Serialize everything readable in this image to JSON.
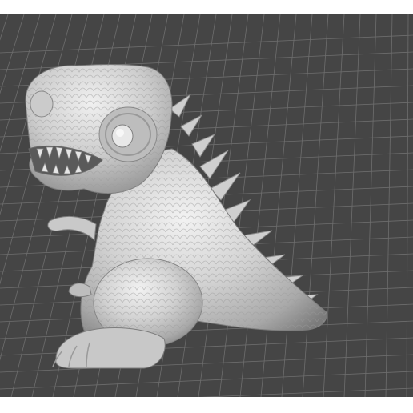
{
  "viewport": {
    "background_color": "#454545",
    "grid_color": "#6e6e6e",
    "model_color": "#d6d6d6",
    "model_name": "dinosaur-model",
    "grid_visible": true
  }
}
